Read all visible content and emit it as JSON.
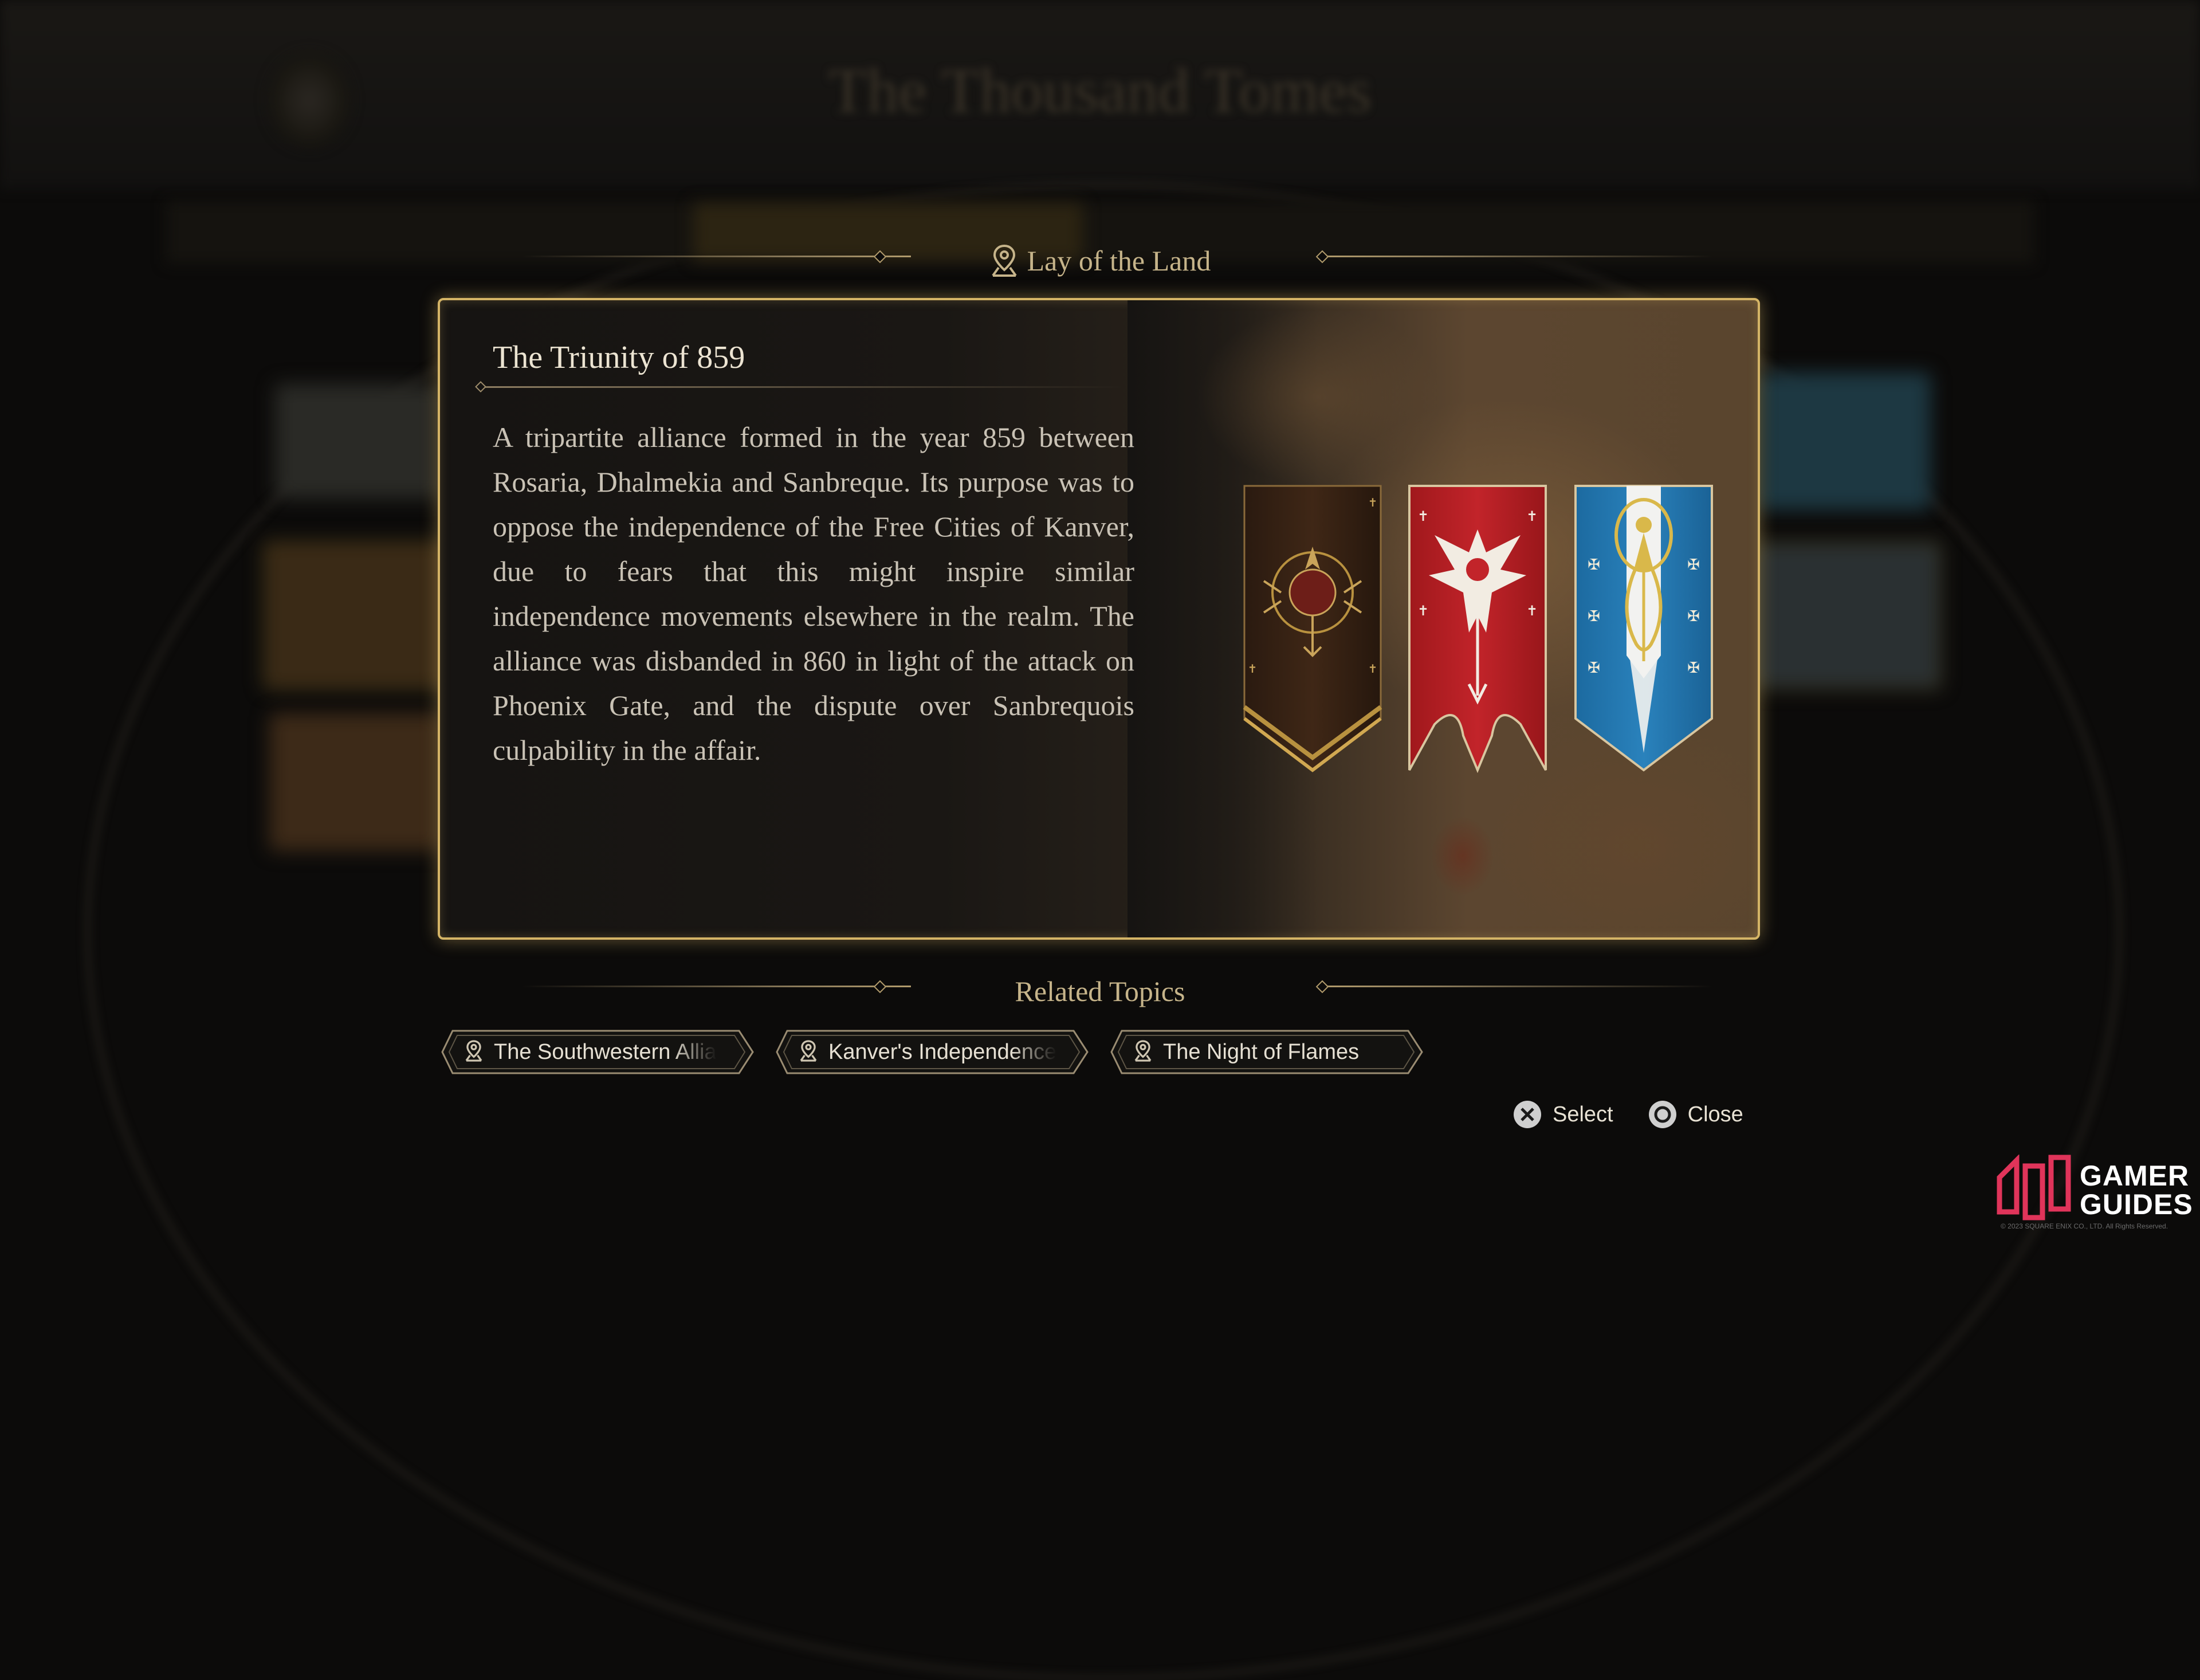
{
  "background": {
    "title": "The Thousand Tomes"
  },
  "header": {
    "section_label": "Lay of the Land",
    "icon": "map-pin-icon"
  },
  "entry": {
    "title": "The Triunity of 859",
    "body": "A tripartite alliance formed in the year 859 between Rosaria, Dhalmekia and Sanbreque. Its purpose was to oppose the independence of the Free Cities of Kanver, due to fears that this might inspire similar independence movements elsewhere in the realm. The alliance was disbanded in 860 in light of the attack on Phoenix Gate, and the dispute over Sanbrequois culpability in the affair.",
    "banners": [
      {
        "name": "rosaria-banner",
        "color": "#3a2414"
      },
      {
        "name": "sanbreque-banner",
        "color": "#b81e22"
      },
      {
        "name": "dhalmekia-banner",
        "color": "#2276b0"
      }
    ]
  },
  "related": {
    "label": "Related Topics",
    "topics": [
      {
        "label": "The Southwestern Allia",
        "icon": "map-pin-icon"
      },
      {
        "label": "Kanver's Independence",
        "icon": "map-pin-icon"
      },
      {
        "label": "The Night of Flames",
        "icon": "map-pin-icon"
      }
    ]
  },
  "prompts": {
    "select": {
      "label": "Select",
      "icon": "cross-button-icon"
    },
    "close": {
      "label": "Close",
      "icon": "circle-button-icon"
    }
  },
  "watermark": {
    "brand_line1": "GAMER",
    "brand_line2": "GUIDES",
    "copyright": "© 2023 SQUARE ENIX CO., LTD. All Rights Reserved."
  },
  "colors": {
    "accent_gold": "#d4b466",
    "header_text": "#c6b48a",
    "body_text": "#c9c2b5",
    "watermark_red": "#e0345a"
  }
}
